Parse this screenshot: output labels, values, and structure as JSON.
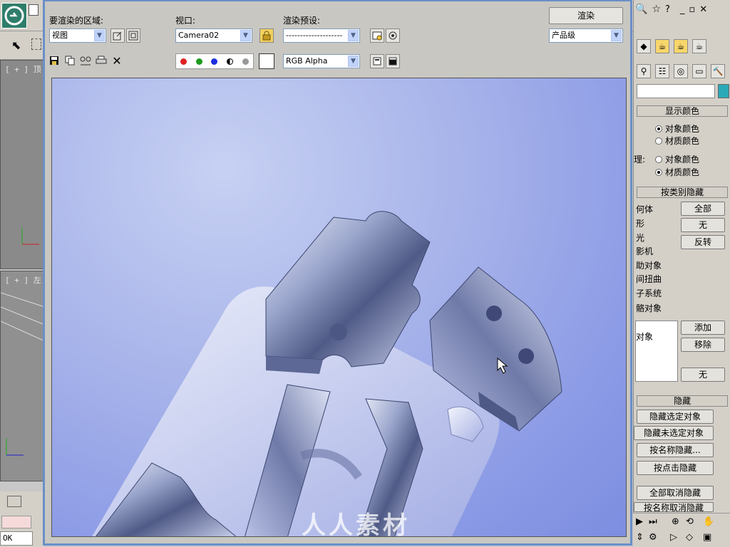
{
  "app": {
    "viewports": [
      {
        "label": "[ + ] 顶"
      },
      {
        "label": "[ + ] 左"
      }
    ],
    "status_text": "OK"
  },
  "render_window": {
    "area_label": "要渲染的区域:",
    "area_value": "视图",
    "viewport_label": "视口:",
    "viewport_value": "Camera02",
    "preset_label": "渲染预设:",
    "preset_value": "--------------------",
    "render_button": "渲染",
    "quality_value": "产品级",
    "channel_value": "RGB Alpha",
    "watermark": "人人素材"
  },
  "command_panel": {
    "display_color": {
      "title": "显示颜色",
      "geometry_options": [
        {
          "label": "对象颜色",
          "selected": true
        },
        {
          "label": "材质颜色",
          "selected": false
        }
      ],
      "shaded_prefix": "理:",
      "shaded_options": [
        {
          "label": "对象颜色",
          "selected": false
        },
        {
          "label": "材质颜色",
          "selected": true
        }
      ]
    },
    "hide_by_category": {
      "title": "按类别隐藏",
      "categories": [
        "何体",
        "形",
        "光",
        "影机",
        "助对象",
        "间扭曲",
        "子系统",
        "骼对象"
      ],
      "buttons": [
        "全部",
        "无",
        "反转"
      ],
      "list_label": "对象",
      "list_buttons": [
        "添加",
        "移除",
        "无"
      ]
    },
    "hide": {
      "title": "隐藏",
      "buttons": [
        "隐藏选定对象",
        "隐藏未选定对象",
        "按名称隐藏...",
        "按点击隐藏",
        "全部取消隐藏",
        "按名称取消隐藏"
      ]
    }
  },
  "colors": {
    "render_bg": "#8d9ce6",
    "window_border": "#6a8fc8",
    "logo": "#2f7d6b"
  }
}
